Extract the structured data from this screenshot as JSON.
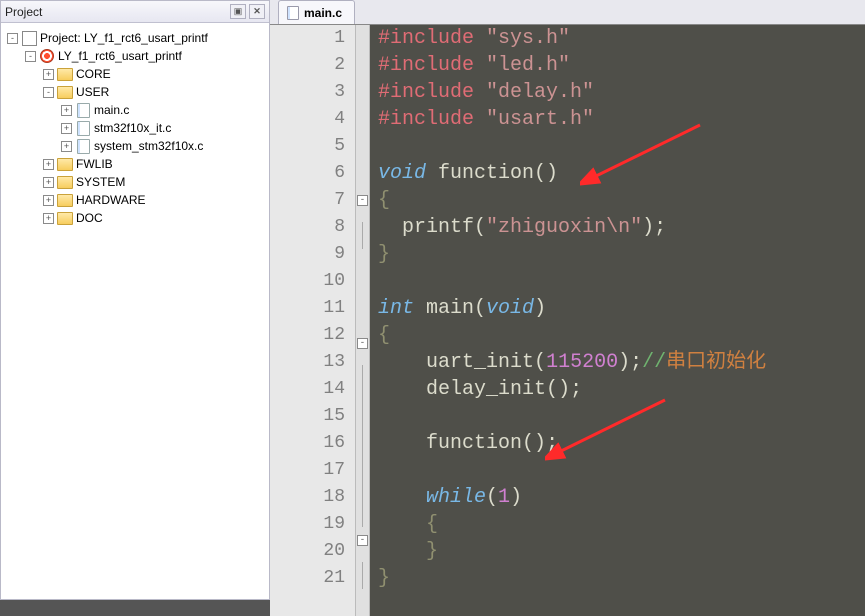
{
  "panel": {
    "title": "Project"
  },
  "tree": {
    "root": {
      "label": "Project: LY_f1_rct6_usart_printf"
    },
    "target": {
      "label": "LY_f1_rct6_usart_printf"
    },
    "folders": {
      "core": "CORE",
      "user": "USER",
      "fwlib": "FWLIB",
      "system": "SYSTEM",
      "hardware": "HARDWARE",
      "doc": "DOC"
    },
    "user_files": {
      "main": "main.c",
      "it": "stm32f10x_it.c",
      "syscfg": "system_stm32f10x.c"
    }
  },
  "tab": {
    "label": "main.c"
  },
  "code": {
    "l1": {
      "pp": "#include",
      "str": "\"sys.h\""
    },
    "l2": {
      "pp": "#include",
      "str": "\"led.h\""
    },
    "l3": {
      "pp": "#include",
      "str": "\"delay.h\""
    },
    "l4": {
      "pp": "#include",
      "str": "\"usart.h\""
    },
    "l6": {
      "kw": "void",
      "fn": " function",
      "paren": "()"
    },
    "l7": {
      "brace": "{"
    },
    "l8": {
      "indent": "  ",
      "fn": "printf",
      "open": "(",
      "str": "\"zhiguoxin\\n\"",
      "close": ")",
      "semi": ";"
    },
    "l9": {
      "brace": "}"
    },
    "l11": {
      "kw": "int",
      "fn": " main",
      "open": "(",
      "arg": "void",
      "close": ")"
    },
    "l12": {
      "brace": "{"
    },
    "l13": {
      "indent": "    ",
      "fn": "uart_init",
      "open": "(",
      "num": "115200",
      "close": ")",
      "semi": ";",
      "cmnt": "//",
      "cjk": "串口初始化"
    },
    "l14": {
      "indent": "    ",
      "fn": "delay_init",
      "open": "(",
      "close": ")",
      "semi": ";"
    },
    "l16": {
      "indent": "    ",
      "fn": "function",
      "open": "(",
      "close": ")",
      "semi": ";"
    },
    "l18": {
      "indent": "    ",
      "kw": "while",
      "open": "(",
      "num": "1",
      "close": ")"
    },
    "l19": {
      "indent": "    ",
      "brace": "{"
    },
    "l20": {
      "indent": "    ",
      "brace": "}"
    },
    "l21": {
      "brace": "}"
    }
  },
  "line_numbers": [
    "1",
    "2",
    "3",
    "4",
    "5",
    "6",
    "7",
    "8",
    "9",
    "10",
    "11",
    "12",
    "13",
    "14",
    "15",
    "16",
    "17",
    "18",
    "19",
    "20",
    "21"
  ],
  "colors": {
    "arrow": "#ff2a2a"
  }
}
